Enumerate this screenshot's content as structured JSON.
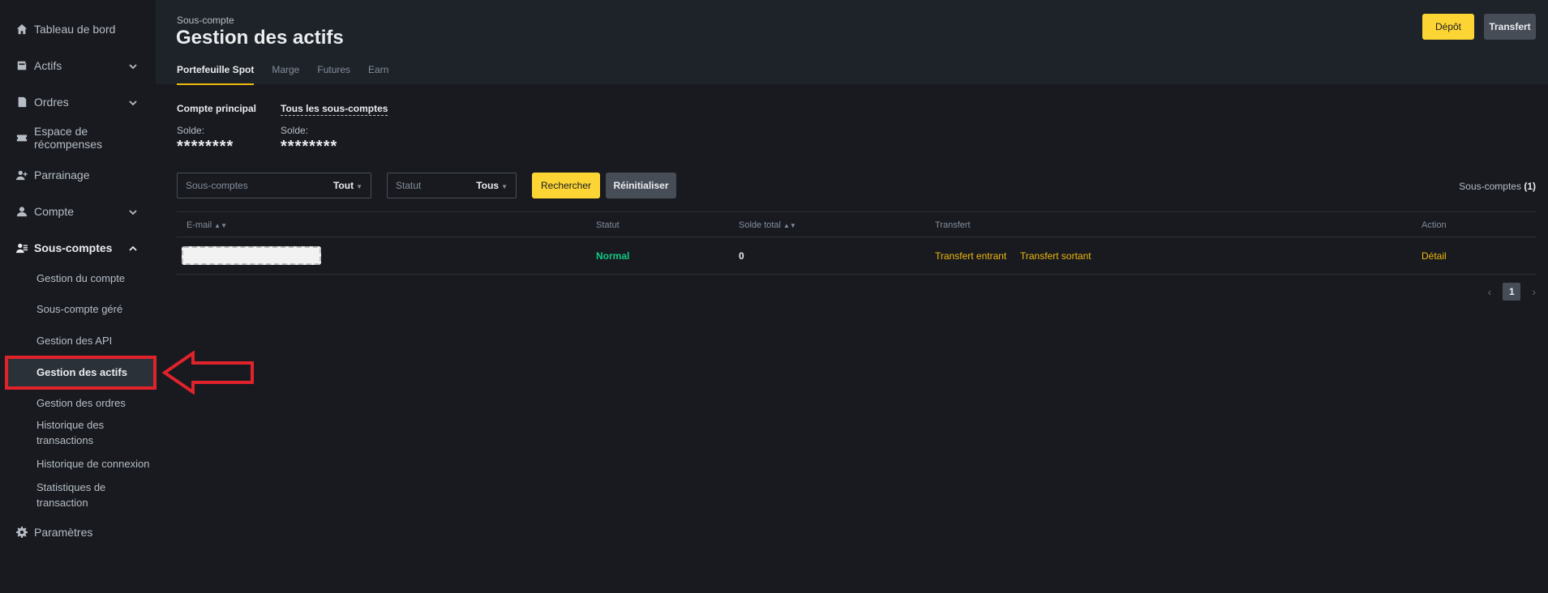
{
  "sidebar": {
    "items": [
      {
        "label": "Tableau de bord",
        "icon": "home-icon"
      },
      {
        "label": "Actifs",
        "icon": "wallet-icon"
      },
      {
        "label": "Ordres",
        "icon": "orders-icon"
      },
      {
        "label": "Espace de récompenses",
        "icon": "ticket-icon"
      },
      {
        "label": "Parrainage",
        "icon": "user-plus-icon"
      },
      {
        "label": "Compte",
        "icon": "user-icon"
      },
      {
        "label": "Sous-comptes",
        "icon": "users-icon"
      },
      {
        "label": "Paramètres",
        "icon": "gear-icon"
      }
    ],
    "sub_items": [
      {
        "label": "Gestion du compte"
      },
      {
        "label": "Sous-compte géré"
      },
      {
        "label": "Gestion des API"
      },
      {
        "label": "Gestion des actifs"
      },
      {
        "label": "Gestion des ordres"
      },
      {
        "label": "Historique des transactions"
      },
      {
        "label": "Historique de connexion"
      },
      {
        "label": "Statistiques de transaction"
      }
    ]
  },
  "header": {
    "breadcrumb": "Sous-compte",
    "title": "Gestion des actifs",
    "tabs": [
      "Portefeuille Spot",
      "Marge",
      "Futures",
      "Earn"
    ],
    "deposit_label": "Dépôt",
    "transfer_label": "Transfert"
  },
  "balances": {
    "main_label": "Compte principal",
    "all_label": "Tous les sous-comptes",
    "balance_label": "Solde:",
    "masked": "********"
  },
  "filters": {
    "subaccounts_placeholder": "Sous-comptes",
    "subaccounts_value": "Tout",
    "status_placeholder": "Statut",
    "status_value": "Tous",
    "search_label": "Rechercher",
    "reset_label": "Réinitialiser",
    "count_label": "Sous-comptes",
    "count_value": "(1)"
  },
  "table": {
    "headers": [
      "E-mail",
      "Statut",
      "Solde total",
      "Transfert",
      "Action"
    ],
    "rows": [
      {
        "status": "Normal",
        "balance": "0",
        "transfer_in": "Transfert entrant",
        "transfer_out": "Transfert sortant",
        "action": "Détail"
      }
    ]
  },
  "pagination": {
    "current": "1"
  },
  "colors": {
    "accent": "#fcd535",
    "status_green": "#0ecb81",
    "link_orange": "#f0b90b",
    "annotation_red": "#e0232b"
  }
}
